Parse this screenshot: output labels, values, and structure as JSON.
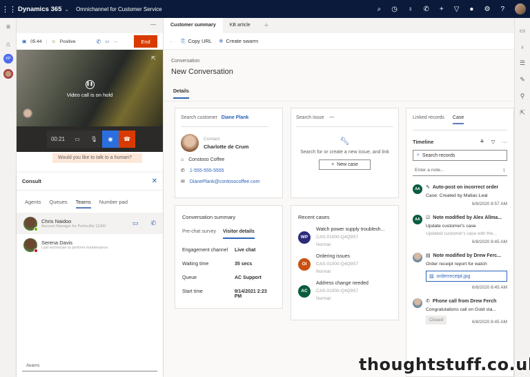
{
  "topbar": {
    "app": "Dynamics 365",
    "area": "Omnichannel for Customer Service",
    "icons": [
      "search-icon",
      "task-icon",
      "lightbulb-icon",
      "phone-icon",
      "plus-icon",
      "filter-icon",
      "status-icon",
      "settings-icon",
      "help-icon"
    ]
  },
  "left": {
    "timer": "05:44",
    "sentiment": "Positive",
    "end": "End",
    "video_status": "Video call is on hold",
    "call_time": "00:21",
    "chat_bubble": "Would you like to talk to a human?",
    "consult": {
      "title": "Consult",
      "tabs": [
        "Agents",
        "Queues",
        "Teams",
        "Number pad"
      ],
      "people": [
        {
          "name": "Chris Naidoo",
          "sub": "Account Manager for PerfectAir 11200"
        },
        {
          "name": "Serena Davis",
          "sub": "Last technician to perform maintenance"
        }
      ],
      "input": "/teams"
    }
  },
  "tabs": [
    "Customer summary",
    "KB article"
  ],
  "toolbar": {
    "copy": "Copy URL",
    "swarm": "Create swarm"
  },
  "page": {
    "crumb": "Conversation",
    "title": "New Conversation",
    "tab": "Details"
  },
  "customer": {
    "label": "Search customer",
    "value": "Diane Plank",
    "contact_lbl": "Contact",
    "name": "Charlotte de Crum",
    "company": "Constoso Coffee",
    "phone": "1-555-555-5555",
    "email": "DianePlank@contosocoffee.com"
  },
  "issue": {
    "label": "Search issue",
    "value": "---",
    "hint": "Search for or create a new issue, and link",
    "new": "New case"
  },
  "summary": {
    "title": "Conversation summary",
    "tabs": [
      "Pre-chat survey",
      "Visitor details"
    ],
    "rows": [
      {
        "k": "Engagement channel",
        "v": "Live chat"
      },
      {
        "k": "Waiting time",
        "v": "35 secs"
      },
      {
        "k": "Queue",
        "v": "AC Support"
      },
      {
        "k": "Start time",
        "v": "9/14/2021 2:23 PM"
      }
    ]
  },
  "recent": {
    "title": "Recent cases",
    "cases": [
      {
        "init": "WP",
        "color": "#2e2a7a",
        "title": "Watch power supply troublesh...",
        "id": "CAS-01000-Q4Q9S7",
        "pri": "Normal"
      },
      {
        "init": "OI",
        "color": "#ca5010",
        "title": "Ordering issues",
        "id": "CAS-01000-Q4Q9S7",
        "pri": "Normal"
      },
      {
        "init": "AC",
        "color": "#0b5c3e",
        "title": "Address change needed",
        "id": "CAS-01000-Q4Q9S7",
        "pri": "Normal"
      }
    ]
  },
  "timeline": {
    "tabs": [
      "Linked records",
      "Case"
    ],
    "title": "Timeline",
    "search": "Search records",
    "note": "Enter a note...",
    "items": [
      {
        "av": "AA",
        "title": "Auto-post on incorrect order",
        "sub": "Case: Created by Matias Leal",
        "date": "6/8/2020 8:57 AM"
      },
      {
        "av": "AA",
        "title": "Note modified by Alex Allma...",
        "sub": "Update customer's case",
        "gray": "Updated customer's case with the...",
        "date": "6/8/2020 8:45 AM"
      },
      {
        "title": "Note modified by Drew Ferc...",
        "sub": "Order receipt report for watch",
        "file": "orderreceipt.jpg",
        "date": "6/8/2020 8:45 AM"
      },
      {
        "title": "Phone call from Drew Ferch",
        "sub": "Congratulations call on Gold sta...",
        "badge": "Closed",
        "date": "6/8/2020 8:45 AM"
      }
    ]
  },
  "watermark": "thoughtstuff.co.uk"
}
